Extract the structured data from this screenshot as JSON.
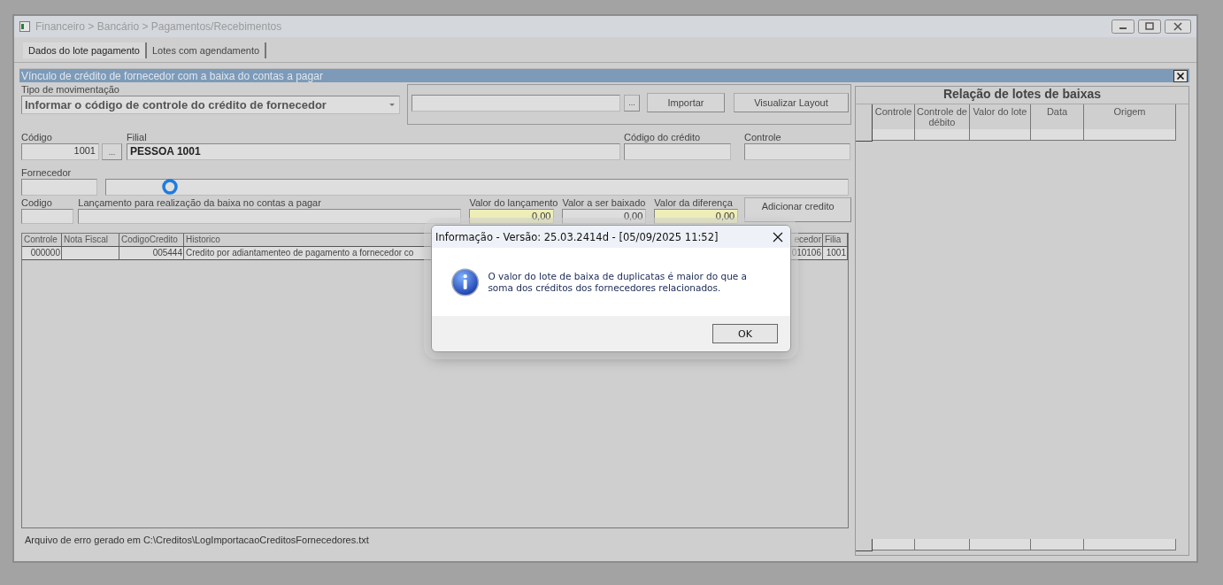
{
  "window": {
    "title": "Financeiro > Bancário > Pagamentos/Recebimentos"
  },
  "tabs": [
    {
      "label": "Dados do lote pagamento",
      "selected": true
    },
    {
      "label": "Lotes com agendamento",
      "selected": false
    }
  ],
  "panel": {
    "title": "Vínculo de crédito de fornecedor com a baixa do contas a pagar"
  },
  "form": {
    "movement_type": {
      "label": "Tipo de  movimentação",
      "value": "Informar o código de controle do crédito de fornecedor"
    },
    "import": {
      "browse_button": "...",
      "buttons": [
        "Importar",
        "Visualizar Layout"
      ]
    },
    "codigo": {
      "label": "Código",
      "value": "1001",
      "browse_button": "..."
    },
    "filial": {
      "label": "Filial",
      "value": "PESSOA 1001"
    },
    "codigo_credito": {
      "label": "Código do crédito"
    },
    "controle": {
      "label": "Controle"
    },
    "fornecedor": {
      "label": "Fornecedor"
    },
    "codigo_lancamento": {
      "label": "Codigo"
    },
    "lancamento": {
      "label": "Lançamento para realização da baixa no contas a pagar"
    },
    "values": [
      {
        "label": "Valor do lançamento",
        "value": "0,00",
        "highlighted": true
      },
      {
        "label": "Valor a ser baixado",
        "value": "0,00",
        "highlighted": false
      },
      {
        "label": "Valor da diferença",
        "value": "0,00",
        "highlighted": true
      }
    ],
    "add_button": "Adicionar credito"
  },
  "credits_table": {
    "columns": [
      "Controle",
      "Nota Fiscal",
      "CodigoCredito",
      "Historico",
      "ecedor",
      "Filia"
    ],
    "rows": [
      [
        "000000",
        null,
        "005444",
        "Credito por adiantamenteo de pagamento a fornecedor co",
        "010106",
        "1001"
      ]
    ]
  },
  "status_text": "Arquivo de erro gerado em C:\\Creditos\\LogImportacaoCreditosFornecedores.txt",
  "lots": {
    "title": "Relação de lotes de baixas",
    "columns": [
      "Controle",
      "Controle de débito",
      "Valor do lote",
      "Data",
      "Origem"
    ]
  },
  "dialog": {
    "title": "Informação - Versão: 25.03.2414d - [05/09/2025 11:52]",
    "message": "O valor do lote de baixa de duplicatas é maior do que a soma dos créditos dos fornecedores relacionados.",
    "buttons": [
      "OK"
    ]
  }
}
